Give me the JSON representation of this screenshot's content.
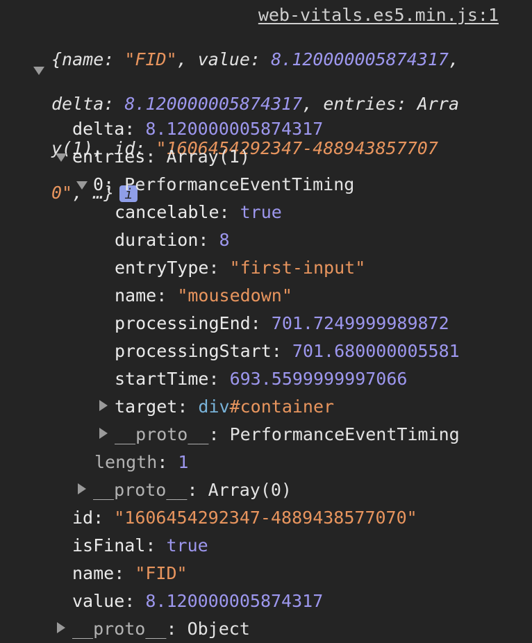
{
  "source_link": "web-vitals.es5.min.js:1",
  "summary": {
    "line1_prefix": "{name: ",
    "line1_name": "\"FID\"",
    "line1_mid": ", value: ",
    "line1_value": "8.120000005874317",
    "line1_end": ",",
    "line2_prefix": "delta: ",
    "line2_delta": "8.120000005874317",
    "line2_end": ", entries: Arra",
    "line3_prefix": "y(1), id: ",
    "line3_id": "\"1606454292347-488943857707",
    "line4_id": "0\"",
    "line4_end": ", …}",
    "info_icon": "i"
  },
  "props": {
    "delta_key": "delta",
    "delta_val": "8.120000005874317",
    "entries_key": "entries",
    "entries_val": "Array(1)",
    "entry0_key": "0",
    "entry0_val": "PerformanceEventTiming",
    "cancelable_key": "cancelable",
    "cancelable_val": "true",
    "duration_key": "duration",
    "duration_val": "8",
    "entryType_key": "entryType",
    "entryType_val": "\"first-input\"",
    "name_key": "name",
    "name_val": "\"mousedown\"",
    "processingEnd_key": "processingEnd",
    "processingEnd_val": "701.7249999989872",
    "processingStart_key": "processingStart",
    "processingStart_val": "701.680000005581",
    "startTime_key": "startTime",
    "startTime_val": "693.5599999997066",
    "target_key": "target",
    "target_tag": "div",
    "target_id": "#container",
    "entry_proto_key": "__proto__",
    "entry_proto_val": "PerformanceEventTiming",
    "length_key": "length",
    "length_val": "1",
    "array_proto_key": "__proto__",
    "array_proto_val": "Array(0)",
    "id_key": "id",
    "id_val": "\"1606454292347-4889438577070\"",
    "isFinal_key": "isFinal",
    "isFinal_val": "true",
    "fname_key": "name",
    "fname_val": "\"FID\"",
    "value_key": "value",
    "value_val": "8.120000005874317",
    "obj_proto_key": "__proto__",
    "obj_proto_val": "Object"
  }
}
